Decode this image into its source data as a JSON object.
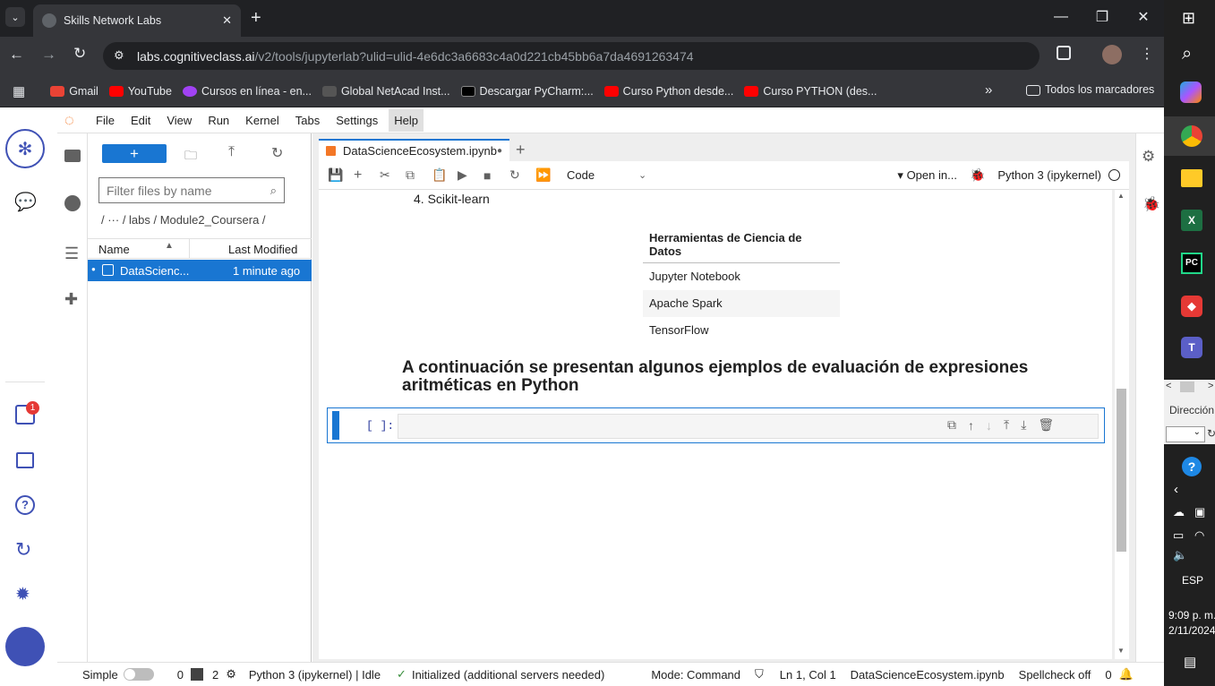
{
  "browser": {
    "tab_title": "Skills Network Labs",
    "url_host": "labs.cognitiveclass.ai",
    "url_path": "/v2/tools/jupyterlab?ulid=ulid-4e6dc3a6683c4a0d221cb45bb6a7da4691263474",
    "bookmarks": [
      "Gmail",
      "YouTube",
      "Cursos en línea - en...",
      "Global NetAcad Inst...",
      "Descargar PyCharm:...",
      "Curso Python desde...",
      "Curso PYTHON (des..."
    ],
    "bookmarks_overflow": "»",
    "all_bookmarks": "Todos los marcadores"
  },
  "jupyter": {
    "menu": [
      "File",
      "Edit",
      "View",
      "Run",
      "Kernel",
      "Tabs",
      "Settings",
      "Help"
    ],
    "filter_placeholder": "Filter files by name",
    "breadcrumb": "/  ···  / labs / Module2_Coursera /",
    "col_name": "Name",
    "col_modified": "Last Modified",
    "file_name": "DataScienc...",
    "file_modified": "1 minute ago",
    "notebook_tab": "DataScienceEcosystem.ipynb",
    "cell_type": "Code",
    "open_in": "Open in...",
    "kernel": "Python 3 (ipykernel)",
    "list_item": "4. Scikit-learn",
    "table_header": "Herramientas de Ciencia de Datos",
    "table_rows": [
      "Jupyter Notebook",
      "Apache Spark",
      "TensorFlow"
    ],
    "heading": "A continuación se presentan algunos ejemplos de evaluación de expresiones aritméticas en Python",
    "prompt": "[ ]:",
    "badge": "1"
  },
  "status": {
    "simple": "Simple",
    "zero": "0",
    "two": "2",
    "kernel_status": "Python 3 (ipykernel) | Idle",
    "init": "Initialized (additional servers needed)",
    "mode": "Mode: Command",
    "position": "Ln 1, Col 1",
    "file": "DataScienceEcosystem.ipynb",
    "spellcheck": "Spellcheck off",
    "count": "0"
  },
  "taskbar": {
    "direction": "Dirección",
    "lang": "ESP",
    "time": "9:09 p. m.",
    "date": "2/11/2024"
  },
  "colors": {
    "accent": "#1976d2",
    "dark": "#202124",
    "chrome": "#35363a"
  }
}
